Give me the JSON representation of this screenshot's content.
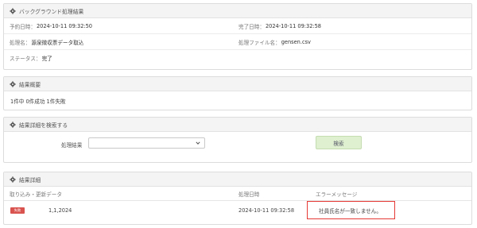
{
  "background_result": {
    "title": "バックグラウンド処理結果",
    "scheduled_label": "予約日時：",
    "scheduled_value": "2024-10-11 09:32:50",
    "completed_label": "完了日時：",
    "completed_value": "2024-10-11 09:32:58",
    "process_name_label": "処理名：",
    "process_name_value": "源泉徴収票データ取込",
    "process_file_label": "処理ファイル名：",
    "process_file_value": "gensen.csv",
    "status_label": "ステータス：",
    "status_value": "完了"
  },
  "summary": {
    "title": "結果概要",
    "text": "1件中 0件成功 1件失敗"
  },
  "search": {
    "title": "結果詳細を検索する",
    "result_label": "処理結果",
    "select_value": "",
    "button_label": "検索"
  },
  "details": {
    "title": "結果詳細",
    "columns": [
      "取り込み・更新データ",
      "処理日時",
      "エラーメッセージ"
    ],
    "rows": [
      {
        "badge": "失敗",
        "data": "1,1,2024",
        "datetime": "2024-10-11 09:32:58",
        "error": "社員氏名が一致しません。"
      }
    ]
  }
}
